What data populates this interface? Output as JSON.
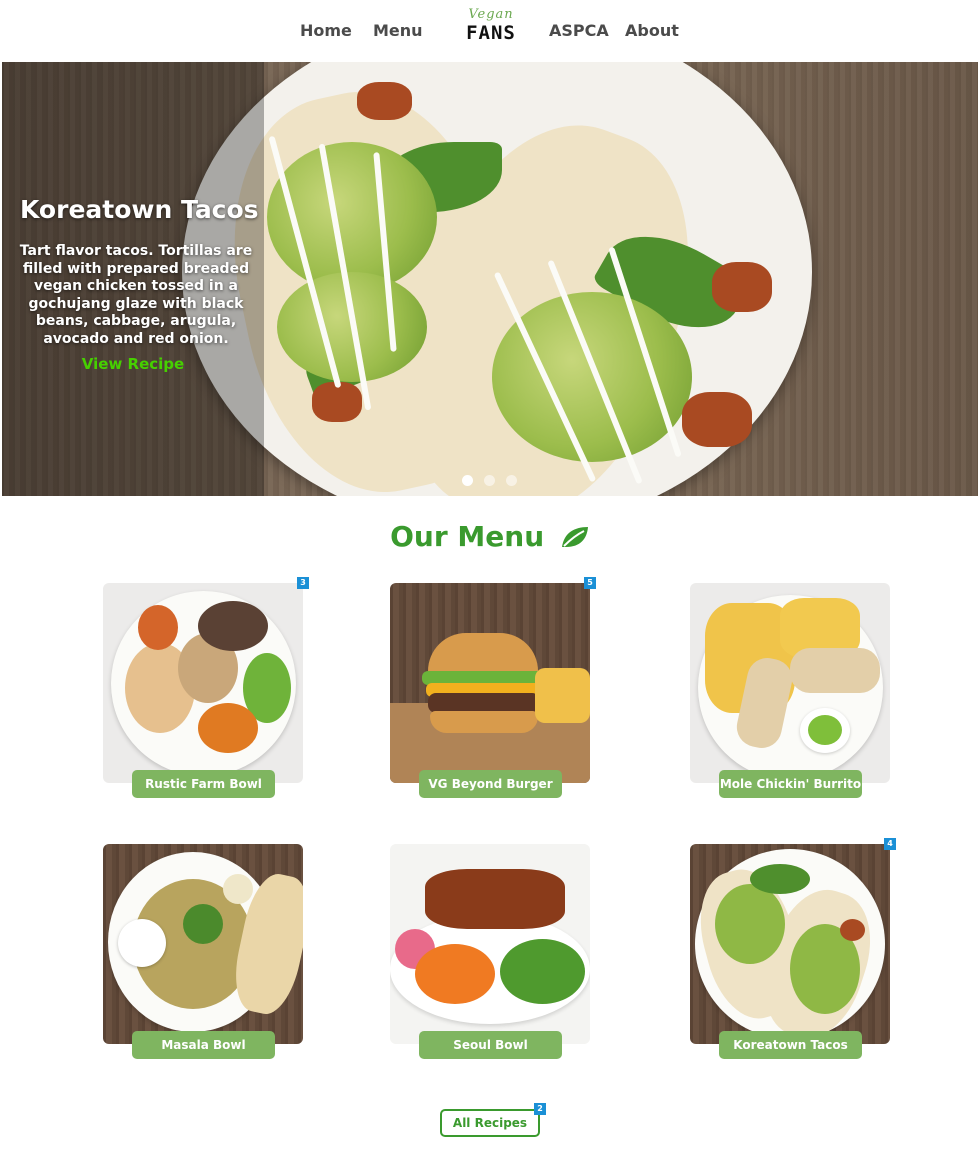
{
  "nav": {
    "links_left": [
      "Home",
      "Menu"
    ],
    "links_right": [
      "ASPCA",
      "About"
    ],
    "logo_script": "Vegan",
    "logo_main": "FANS"
  },
  "hero": {
    "title": "Koreatown Tacos",
    "description": "Tart flavor tacos. Tortillas are filled with prepared breaded vegan chicken tossed in a gochujang glaze with black beans, cabbage, arugula, avocado and red onion.",
    "link": "View Recipe",
    "slides": 3,
    "active_slide": 1
  },
  "menu": {
    "title": "Our Menu",
    "title_icon": "leaf-icon",
    "items": [
      {
        "label": "Rustic Farm Bowl",
        "badge": "3"
      },
      {
        "label": "VG Beyond Burger",
        "badge": "5"
      },
      {
        "label": "Mole Chickin' Burrito",
        "badge": ""
      },
      {
        "label": "Masala Bowl",
        "badge": ""
      },
      {
        "label": "Seoul Bowl",
        "badge": ""
      },
      {
        "label": "Koreatown Tacos",
        "badge": "4"
      }
    ],
    "all_recipes": "All Recipes",
    "all_recipes_badge": "2"
  },
  "colors": {
    "accent_green": "#3a9a2e",
    "button_green": "#7fb560",
    "hero_link_green": "#46d000",
    "badge_blue": "#1b90d6"
  }
}
